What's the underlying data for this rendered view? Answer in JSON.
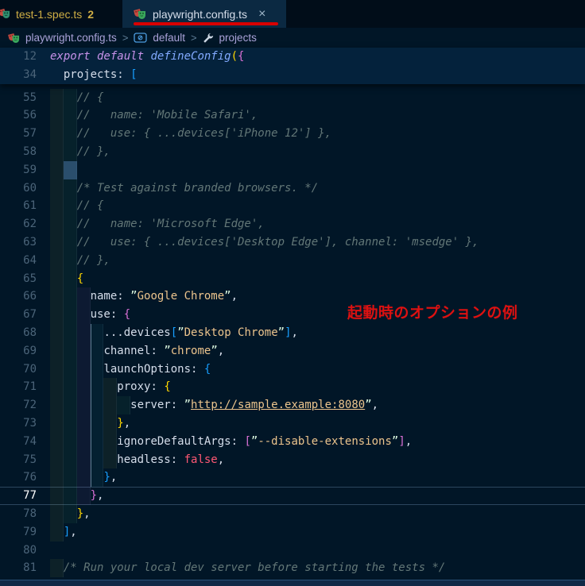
{
  "tabs": [
    {
      "label": "test-1.spec.ts",
      "badge": "2",
      "state": "modified"
    },
    {
      "label": "playwright.config.ts",
      "close_glyph": "×",
      "active": true
    }
  ],
  "breadcrumb": {
    "separator": ">",
    "items": [
      {
        "label": "playwright.config.ts",
        "icon": "playwright-masks"
      },
      {
        "label": "default",
        "icon": "symbol-default-export"
      },
      {
        "label": "projects",
        "icon": "symbol-property-wrench"
      }
    ]
  },
  "annotation": {
    "note": "起動時のオプションの例",
    "note_color": "#dd1111",
    "tab_underline_color": "#d90000"
  },
  "colors": {
    "editor_background": "#011627",
    "active_tab_background": "#0b2942",
    "modified_tab_label": "#cfae45",
    "line_number": "#4b6479",
    "string": "#ecc48d",
    "comment": "#637777",
    "keyword": "#c792ea",
    "function": "#82aaff",
    "boolean": "#ff5874",
    "bracket_gold": "#ffd700",
    "bracket_pink": "#da70d6",
    "bracket_blue": "#179fff"
  },
  "editor": {
    "first_line_num": 55,
    "guide": {
      "from_line": 68,
      "to_line": 76,
      "column": 6
    },
    "sticky": [
      {
        "num": 12,
        "segments": [
          [
            "kw",
            "export default"
          ],
          [
            "pl",
            " "
          ],
          [
            "fn",
            "defineConfig"
          ],
          [
            "b1",
            "("
          ],
          [
            "b2",
            "{"
          ]
        ]
      },
      {
        "num": 34,
        "segments": [
          [
            "pl",
            "  "
          ],
          [
            "pr",
            "projects"
          ],
          [
            "pu",
            ": "
          ],
          [
            "b3",
            "["
          ]
        ]
      }
    ],
    "lines": [
      {
        "num": 55,
        "indent": 2,
        "segments": [
          [
            "pl",
            "    "
          ],
          [
            "c",
            "// {"
          ]
        ]
      },
      {
        "num": 56,
        "indent": 2,
        "segments": [
          [
            "pl",
            "    "
          ],
          [
            "c",
            "//   name: 'Mobile Safari',"
          ]
        ]
      },
      {
        "num": 57,
        "indent": 2,
        "segments": [
          [
            "pl",
            "    "
          ],
          [
            "c",
            "//   use: { ...devices['iPhone 12'] },"
          ]
        ]
      },
      {
        "num": 58,
        "indent": 2,
        "segments": [
          [
            "pl",
            "    "
          ],
          [
            "c",
            "// },"
          ]
        ]
      },
      {
        "num": 59,
        "indent": 2,
        "bright": 1,
        "segments": []
      },
      {
        "num": 60,
        "indent": 2,
        "segments": [
          [
            "pl",
            "    "
          ],
          [
            "c",
            "/* Test against branded browsers. */"
          ]
        ]
      },
      {
        "num": 61,
        "indent": 2,
        "segments": [
          [
            "pl",
            "    "
          ],
          [
            "c",
            "// {"
          ]
        ]
      },
      {
        "num": 62,
        "indent": 2,
        "segments": [
          [
            "pl",
            "    "
          ],
          [
            "c",
            "//   name: 'Microsoft Edge',"
          ]
        ]
      },
      {
        "num": 63,
        "indent": 2,
        "segments": [
          [
            "pl",
            "    "
          ],
          [
            "c",
            "//   use: { ...devices['Desktop Edge'], channel: 'msedge' },"
          ]
        ]
      },
      {
        "num": 64,
        "indent": 2,
        "segments": [
          [
            "pl",
            "    "
          ],
          [
            "c",
            "// },"
          ]
        ]
      },
      {
        "num": 65,
        "indent": 2,
        "segments": [
          [
            "pl",
            "    "
          ],
          [
            "b1",
            "{"
          ]
        ]
      },
      {
        "num": 66,
        "indent": 3,
        "segments": [
          [
            "pl",
            "      "
          ],
          [
            "pr",
            "name"
          ],
          [
            "pu",
            ": "
          ],
          [
            "q",
            "”"
          ],
          [
            "s",
            "Google Chrome"
          ],
          [
            "q",
            "”"
          ],
          [
            "pu",
            ","
          ]
        ]
      },
      {
        "num": 67,
        "indent": 3,
        "segments": [
          [
            "pl",
            "      "
          ],
          [
            "pr",
            "use"
          ],
          [
            "pu",
            ": "
          ],
          [
            "b2",
            "{"
          ]
        ]
      },
      {
        "num": 68,
        "indent": 4,
        "segments": [
          [
            "pl",
            "        "
          ],
          [
            "pu",
            "..."
          ],
          [
            "pr",
            "devices"
          ],
          [
            "b3",
            "["
          ],
          [
            "q",
            "”"
          ],
          [
            "s",
            "Desktop Chrome"
          ],
          [
            "q",
            "”"
          ],
          [
            "b3",
            "]"
          ],
          [
            "pu",
            ","
          ]
        ]
      },
      {
        "num": 69,
        "indent": 4,
        "segments": [
          [
            "pl",
            "        "
          ],
          [
            "pr",
            "channel"
          ],
          [
            "pu",
            ": "
          ],
          [
            "q",
            "”"
          ],
          [
            "s",
            "chrome"
          ],
          [
            "q",
            "”"
          ],
          [
            "pu",
            ","
          ]
        ]
      },
      {
        "num": 70,
        "indent": 4,
        "segments": [
          [
            "pl",
            "        "
          ],
          [
            "pr",
            "launchOptions"
          ],
          [
            "pu",
            ": "
          ],
          [
            "b3",
            "{"
          ]
        ]
      },
      {
        "num": 71,
        "indent": 5,
        "segments": [
          [
            "pl",
            "          "
          ],
          [
            "pr",
            "proxy"
          ],
          [
            "pu",
            ": "
          ],
          [
            "b1",
            "{"
          ]
        ]
      },
      {
        "num": 72,
        "indent": 6,
        "segments": [
          [
            "pl",
            "            "
          ],
          [
            "pr",
            "server"
          ],
          [
            "pu",
            ": "
          ],
          [
            "q",
            "”"
          ],
          [
            "lk",
            "http://sample.example:8080"
          ],
          [
            "q",
            "”"
          ],
          [
            "pu",
            ","
          ]
        ]
      },
      {
        "num": 73,
        "indent": 5,
        "segments": [
          [
            "pl",
            "          "
          ],
          [
            "b1",
            "}"
          ],
          [
            "pu",
            ","
          ]
        ]
      },
      {
        "num": 74,
        "indent": 5,
        "segments": [
          [
            "pl",
            "          "
          ],
          [
            "pr",
            "ignoreDefaultArgs"
          ],
          [
            "pu",
            ": "
          ],
          [
            "b2",
            "["
          ],
          [
            "q",
            "”"
          ],
          [
            "s",
            "--disable-extensions"
          ],
          [
            "q",
            "”"
          ],
          [
            "b2",
            "]"
          ],
          [
            "pu",
            ","
          ]
        ]
      },
      {
        "num": 75,
        "indent": 5,
        "segments": [
          [
            "pl",
            "          "
          ],
          [
            "pr",
            "headless"
          ],
          [
            "pu",
            ": "
          ],
          [
            "bo",
            "false"
          ],
          [
            "pu",
            ","
          ]
        ]
      },
      {
        "num": 76,
        "indent": 4,
        "segments": [
          [
            "pl",
            "        "
          ],
          [
            "b3",
            "}"
          ],
          [
            "pu",
            ","
          ]
        ]
      },
      {
        "num": 77,
        "indent": 3,
        "current": true,
        "segments": [
          [
            "pl",
            "      "
          ],
          [
            "b2",
            "}"
          ],
          [
            "pu",
            ","
          ]
        ]
      },
      {
        "num": 78,
        "indent": 2,
        "segments": [
          [
            "pl",
            "    "
          ],
          [
            "b1",
            "}"
          ],
          [
            "pu",
            ","
          ]
        ]
      },
      {
        "num": 79,
        "indent": 1,
        "segments": [
          [
            "pl",
            "  "
          ],
          [
            "b3",
            "]"
          ],
          [
            "pu",
            ","
          ]
        ]
      },
      {
        "num": 80,
        "indent": 0,
        "segments": []
      },
      {
        "num": 81,
        "indent": 1,
        "segments": [
          [
            "pl",
            "  "
          ],
          [
            "c",
            "/* Run your local dev server before starting the tests */"
          ]
        ]
      }
    ]
  }
}
